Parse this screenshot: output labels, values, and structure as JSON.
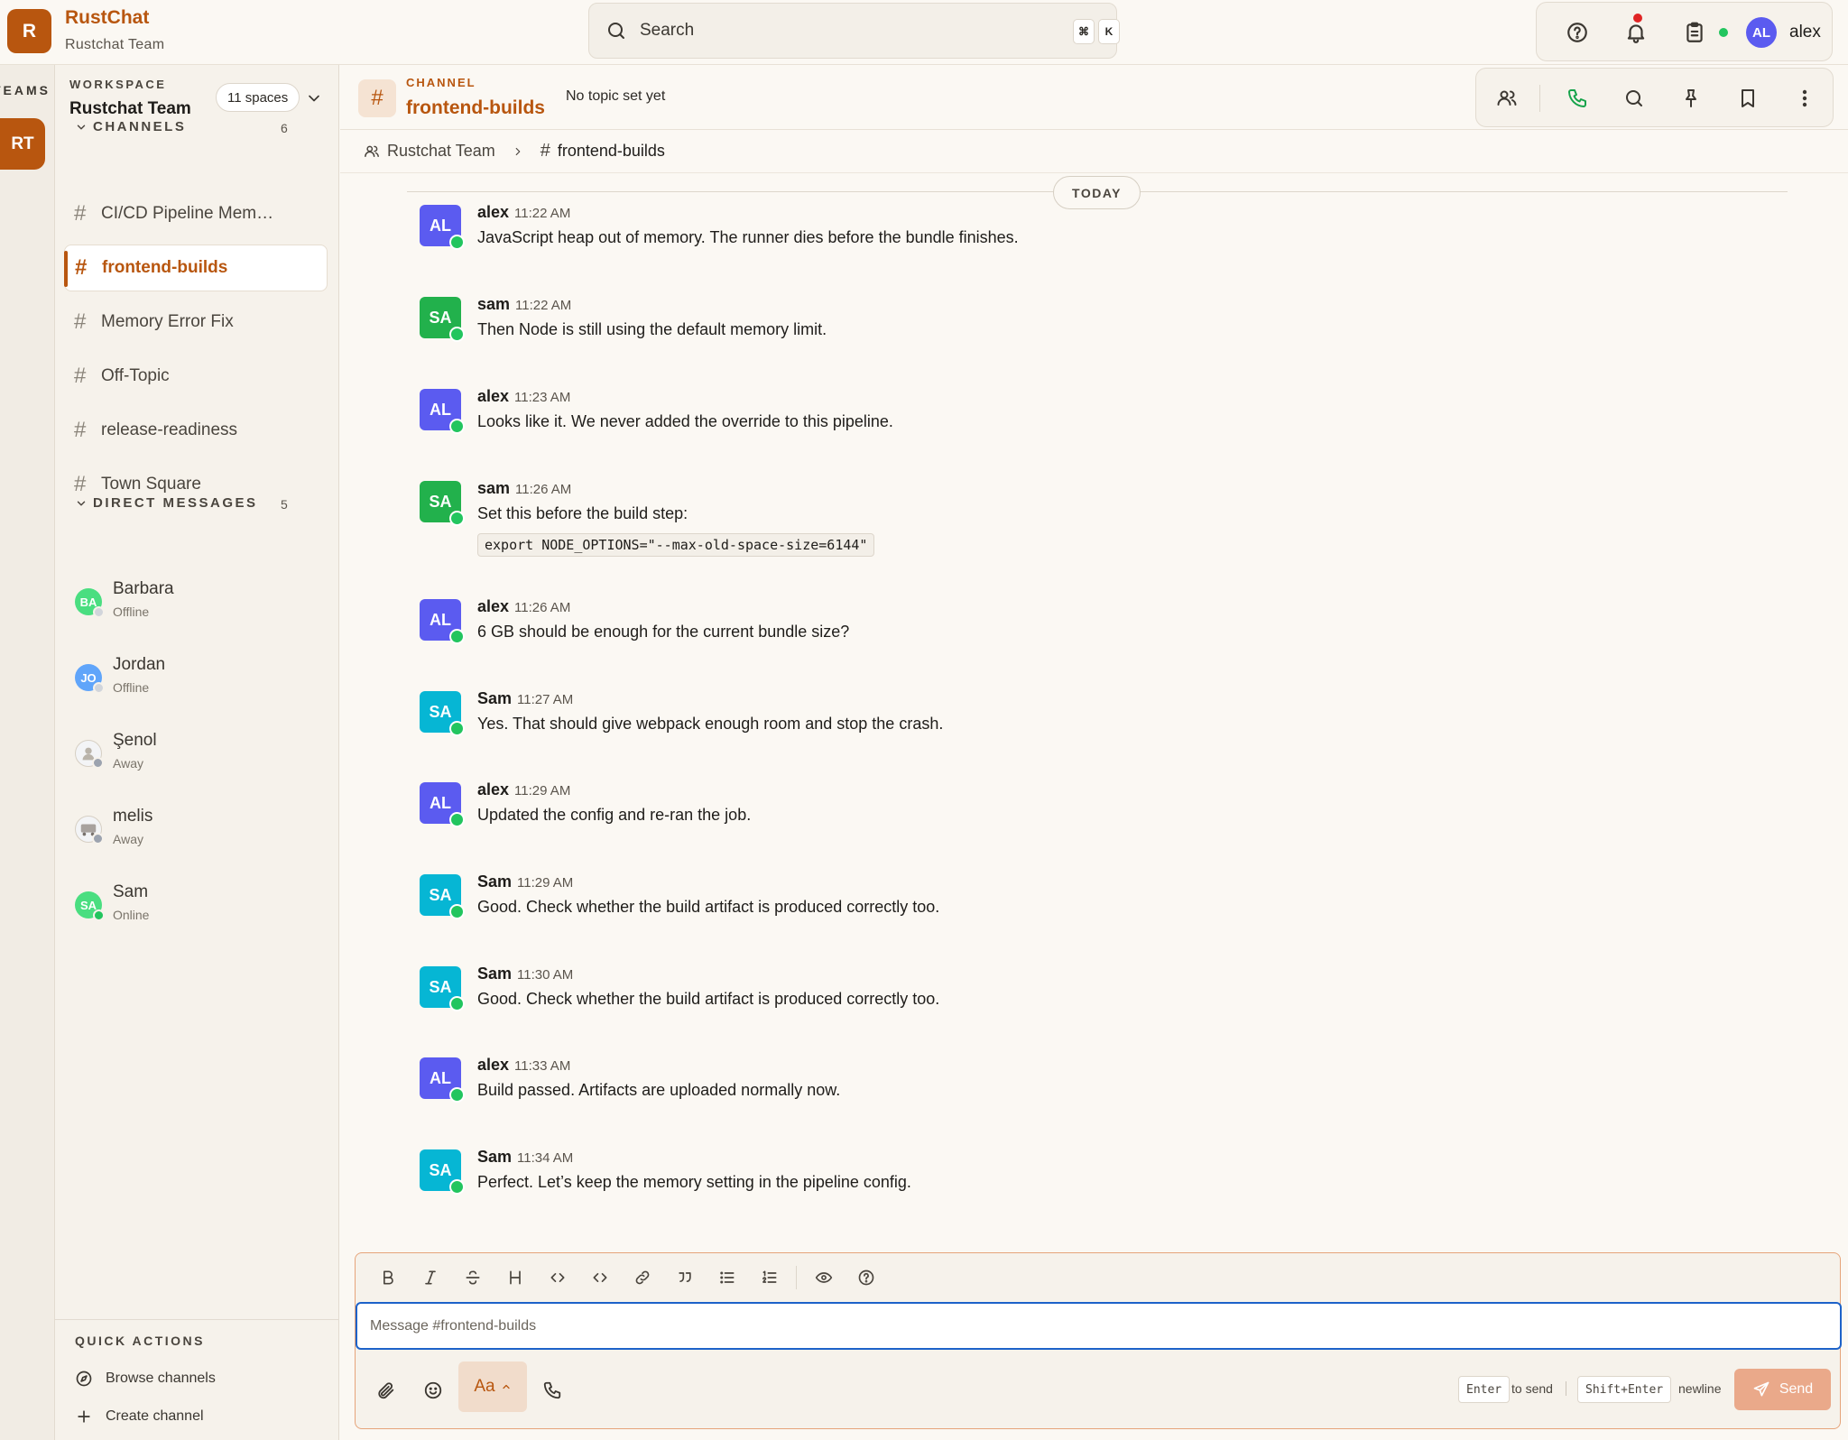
{
  "app": {
    "logo_letter": "R",
    "name": "RustChat",
    "team": "Rustchat Team"
  },
  "search": {
    "placeholder": "Search",
    "kbd1": "⌘",
    "kbd2": "K"
  },
  "user": {
    "initials": "AL",
    "name": "alex"
  },
  "teams": {
    "label": "TEAMS",
    "active_initials": "RT"
  },
  "workspace": {
    "label": "WORKSPACE",
    "name": "Rustchat Team",
    "spaces": "11 spaces"
  },
  "channels": {
    "label": "CHANNELS",
    "count": "6",
    "items": [
      {
        "name": "CI/CD Pipeline Mem…"
      },
      {
        "name": "frontend-builds"
      },
      {
        "name": "Memory Error Fix"
      },
      {
        "name": "Off-Topic"
      },
      {
        "name": "release-readiness"
      },
      {
        "name": "Town Square"
      }
    ]
  },
  "dms": {
    "label": "DIRECT MESSAGES",
    "count": "5",
    "items": [
      {
        "name": "Barbara",
        "status": "Offline",
        "initials": "BA"
      },
      {
        "name": "Jordan",
        "status": "Offline",
        "initials": "JO"
      },
      {
        "name": "Şenol",
        "status": "Away",
        "initials": ""
      },
      {
        "name": "melis",
        "status": "Away",
        "initials": ""
      },
      {
        "name": "Sam",
        "status": "Online",
        "initials": "SA"
      }
    ]
  },
  "quick_actions": {
    "label": "QUICK ACTIONS",
    "browse": "Browse channels",
    "create": "Create channel"
  },
  "channel": {
    "kicker": "CHANNEL",
    "name": "frontend-builds",
    "topic": "No topic set yet"
  },
  "breadcrumb": {
    "team": "Rustchat Team",
    "channel": "frontend-builds"
  },
  "date_divider": "TODAY",
  "messages": [
    {
      "author": "alex",
      "initials": "AL",
      "time": "11:22 AM",
      "text": "JavaScript heap out of memory. The runner dies before the bundle finishes."
    },
    {
      "author": "sam",
      "initials": "SA",
      "time": "11:22 AM",
      "text": "Then Node is still using the default memory limit."
    },
    {
      "author": "alex",
      "initials": "AL",
      "time": "11:23 AM",
      "text": "Looks like it. We never added the override to this pipeline."
    },
    {
      "author": "sam",
      "initials": "SA",
      "time": "11:26 AM",
      "text": "Set this before the build step:",
      "code": "export NODE_OPTIONS=\"--max-old-space-size=6144\""
    },
    {
      "author": "alex",
      "initials": "AL",
      "time": "11:26 AM",
      "text": "6 GB should be enough for the current bundle size?"
    },
    {
      "author": "Sam",
      "initials": "SA",
      "time": "11:27 AM",
      "text": "Yes. That should give webpack enough room and stop the crash."
    },
    {
      "author": "alex",
      "initials": "AL",
      "time": "11:29 AM",
      "text": "Updated the config and re-ran the job."
    },
    {
      "author": "Sam",
      "initials": "SA",
      "time": "11:29 AM",
      "text": "Good. Check whether the build artifact is produced correctly too."
    },
    {
      "author": "Sam",
      "initials": "SA",
      "time": "11:30 AM",
      "text": "Good. Check whether the build artifact is produced correctly too."
    },
    {
      "author": "alex",
      "initials": "AL",
      "time": "11:33 AM",
      "text": "Build passed. Artifacts are uploaded normally now."
    },
    {
      "author": "Sam",
      "initials": "SA",
      "time": "11:34 AM",
      "text": "Perfect. Let’s keep the memory setting in the pipeline config."
    }
  ],
  "composer": {
    "placeholder": "Message #frontend-builds",
    "format_label": "Aa",
    "enter_key": "Enter",
    "enter_hint": "to send",
    "shift_key": "Shift+Enter",
    "shift_hint": "newline",
    "send_label": "Send"
  },
  "colors": {
    "accent": "#b8560f",
    "alex_avatar": "#5b5bf0",
    "sam_avatar": "#22b14c",
    "sam2_avatar": "#06b6d4",
    "online": "#22c55e",
    "input_focus": "#1d62c9"
  }
}
